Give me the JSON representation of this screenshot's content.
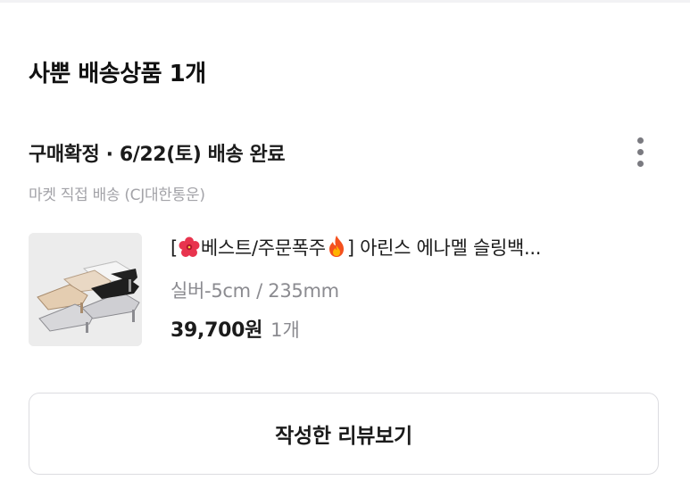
{
  "section": {
    "title": "사뿐 배송상품 1개"
  },
  "order": {
    "status": "구매확정 · 6/22(토) 배송 완료",
    "delivery_method": "마켓 직접 배송 (CJ대한통운)"
  },
  "product": {
    "name_open": "[",
    "name_tag": "베스트/주문폭주",
    "name_rest": "] 아린스 에나멜 슬링백...",
    "option": "실버-5cm / 235mm",
    "price": "39,700원",
    "quantity": "1개",
    "icons": [
      "hibiscus-emoji-icon",
      "fire-emoji-icon",
      "more-vertical-icon"
    ]
  },
  "actions": {
    "review_label": "작성한 리뷰보기"
  },
  "colors": {
    "text_primary": "#1b1b1b",
    "text_secondary": "#8b8b90",
    "border": "#dcdce0",
    "divider": "#f2f2f4"
  }
}
